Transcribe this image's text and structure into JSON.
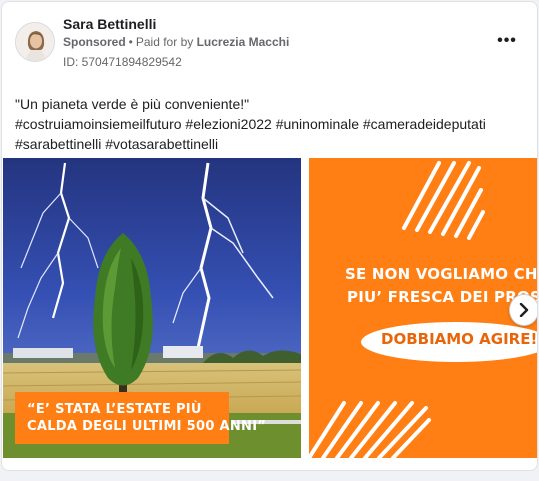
{
  "post": {
    "author": "Sara Bettinelli",
    "sponsored_label": "Sponsored",
    "separator": "•",
    "paid_for_label": "Paid for by",
    "paid_for_name": "Lucrezia Macchi",
    "ad_id": "ID: 570471894829542",
    "caption_lines": [
      "\"Un pianeta verde è più conveniente!\"",
      "#costruiamoinsiemeilfuturo #elezioni2022 #uninominale #cameradeideputati",
      "#sarabettinelli #votasarabettinelli"
    ]
  },
  "carousel": {
    "slide1": {
      "quote_lines": [
        "“E’ STATA L’ESTATE PIÙ",
        "CALDA DEGLI ULTIMI 500 ANNI”"
      ]
    },
    "slide2": {
      "line1": "SE NON VOGLIAMO CHE SI",
      "line2": "PIU’ FRESCA DEI PROS",
      "highlight": "DOBBIAMO AGIRE!"
    }
  },
  "icons": {
    "more": "more-options-icon",
    "next": "chevron-right-icon"
  },
  "colors": {
    "text_primary": "#1c1e21",
    "text_secondary": "#65676b",
    "brand_orange": "#ff7f14",
    "sky_blue": "#2b3f9a"
  }
}
